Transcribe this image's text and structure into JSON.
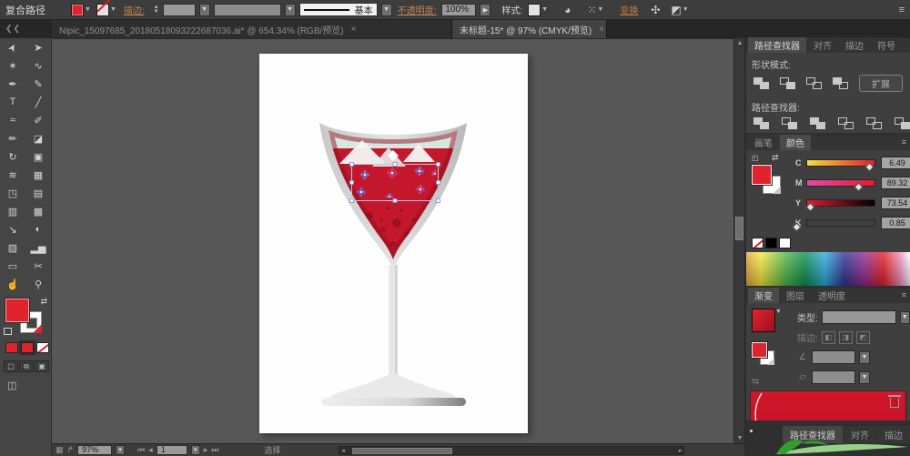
{
  "control_bar": {
    "context_label": "复合路径",
    "stroke_label": "描边:",
    "basic_label": "基本",
    "opacity_label": "不透明度:",
    "opacity_value": "100%",
    "style_label": "样式:",
    "transform_label": "变换",
    "panel_menu_icon": "≡"
  },
  "document_tabs": [
    {
      "title": "Nipic_15097685_20180518093222687036.ai* @ 654.34% (RGB/预览)",
      "close": "×"
    },
    {
      "title": "未标题-15* @ 97% (CMYK/预览)",
      "close": "×"
    }
  ],
  "toolbar": {
    "tools": [
      {
        "name": "selection",
        "glyph": "➤"
      },
      {
        "name": "direct-selection",
        "glyph": "➤"
      },
      {
        "name": "magic-wand",
        "glyph": "✶"
      },
      {
        "name": "lasso",
        "glyph": "∿"
      },
      {
        "name": "pen",
        "glyph": "✒"
      },
      {
        "name": "curvature-pen",
        "glyph": "✎"
      },
      {
        "name": "type",
        "glyph": "T"
      },
      {
        "name": "line-segment",
        "glyph": "╱"
      },
      {
        "name": "shaper",
        "glyph": "≈"
      },
      {
        "name": "paintbrush",
        "glyph": "✐"
      },
      {
        "name": "pencil",
        "glyph": "✏"
      },
      {
        "name": "eraser",
        "glyph": "◪"
      },
      {
        "name": "rotate",
        "glyph": "↻"
      },
      {
        "name": "free-transform",
        "glyph": "▣"
      },
      {
        "name": "width-tool",
        "glyph": "≋"
      },
      {
        "name": "puppet-warp",
        "glyph": "▦"
      },
      {
        "name": "shape-builder",
        "glyph": "◳"
      },
      {
        "name": "perspective-grid",
        "glyph": "▤"
      },
      {
        "name": "mesh",
        "glyph": "▥"
      },
      {
        "name": "gradient",
        "glyph": "▩"
      },
      {
        "name": "eyedropper",
        "glyph": "↘"
      },
      {
        "name": "blend",
        "glyph": "◐"
      },
      {
        "name": "symbol-sprayer",
        "glyph": "▨"
      },
      {
        "name": "column-graph",
        "glyph": "▂▅"
      },
      {
        "name": "artboard",
        "glyph": "▭"
      },
      {
        "name": "slice",
        "glyph": "✂"
      },
      {
        "name": "hand",
        "glyph": "☝"
      },
      {
        "name": "zoom",
        "glyph": "⚲"
      }
    ]
  },
  "panels": {
    "pathfinder": {
      "tabs": [
        "路径查找器",
        "对齐",
        "描边",
        "符号"
      ],
      "shape_modes_label": "形状模式:",
      "expand_button": "扩展",
      "pathfinders_label": "路径查找器:"
    },
    "color": {
      "tab_brushes": "画笔",
      "tab_color": "颜色",
      "channels": [
        {
          "label": "C",
          "value": "6.49",
          "unit": "%"
        },
        {
          "label": "M",
          "value": "89.32",
          "unit": "%"
        },
        {
          "label": "Y",
          "value": "73.54",
          "unit": "%"
        },
        {
          "label": "K",
          "value": "0.85",
          "unit": "%"
        }
      ]
    },
    "gradient": {
      "tab_gradient": "渐变",
      "tab_layers": "图层",
      "tab_transparency": "透明度",
      "type_label": "类型:",
      "stroke_label": "描边:"
    },
    "bottom_tabs": [
      "路径查找器",
      "对齐",
      "描边"
    ]
  },
  "statusbar": {
    "zoom_value": "97%",
    "artboard_value": "1",
    "tool_hint": "选择"
  },
  "artwork_colors": {
    "liquid_red": "#c5172c",
    "bubble_dark_red": "#8c0e1e",
    "glass_gray": "#d6d6d6",
    "air_teal": "#d8e5e1",
    "ice_white": "#f4f6f6",
    "flower_purple": "#7d6cc9",
    "flower_crimson": "#c23a63",
    "selection_blue": "#b9c7e8",
    "watermark_green": "#2f9e2a"
  }
}
